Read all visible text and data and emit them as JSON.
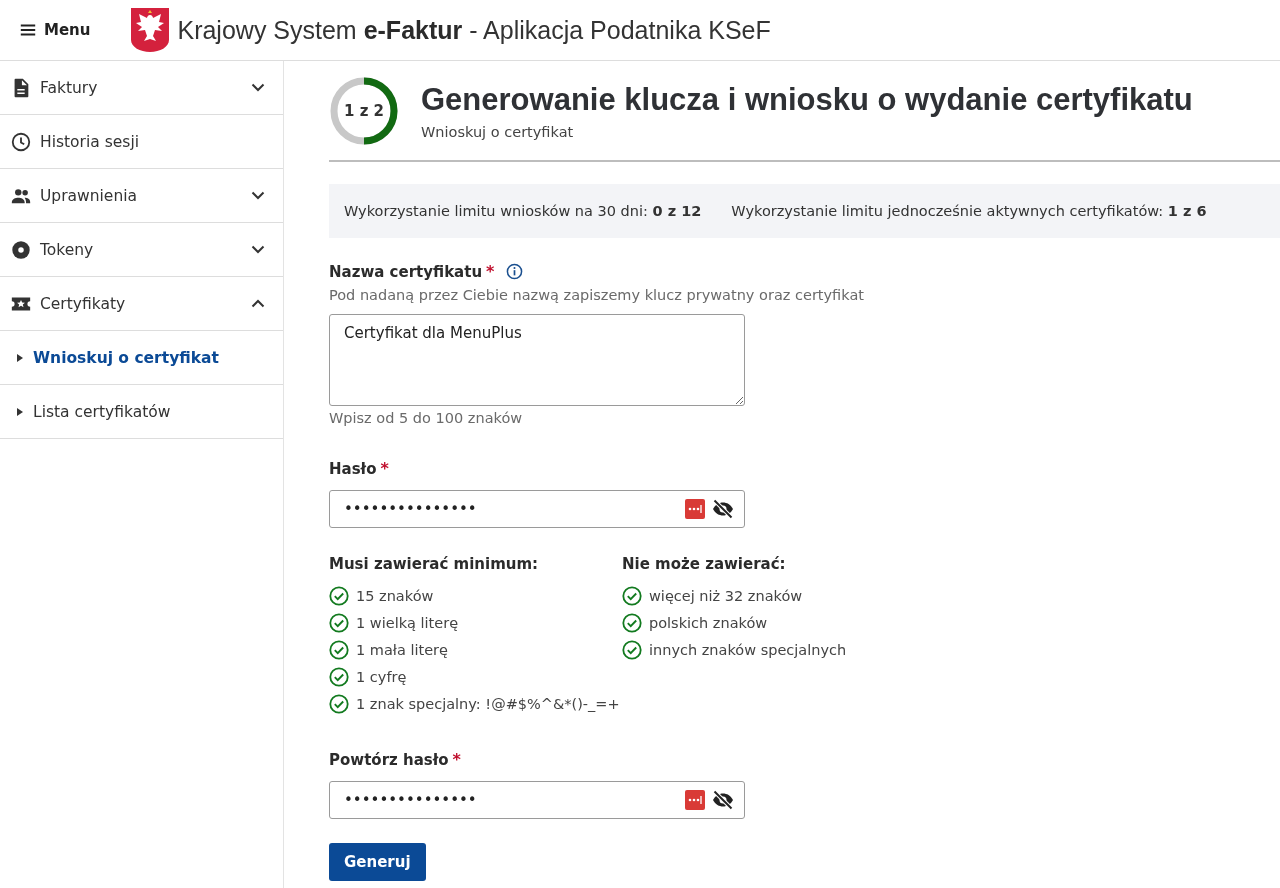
{
  "header": {
    "menu_label": "Menu",
    "title_prefix": "Krajowy System ",
    "title_brand": "e-Faktur",
    "title_suffix": " - Aplikacja Podatnika KSeF"
  },
  "sidebar": {
    "items": [
      {
        "label": "Faktury",
        "kind": "document",
        "expanded": false
      },
      {
        "label": "Historia sesji",
        "kind": "clock"
      },
      {
        "label": "Uprawnienia",
        "kind": "people",
        "expanded": false
      },
      {
        "label": "Tokeny",
        "kind": "token",
        "expanded": false
      },
      {
        "label": "Certyfikaty",
        "kind": "ticket",
        "expanded": true,
        "children": [
          {
            "label": "Wnioskuj o certyfikat",
            "selected": true
          },
          {
            "label": "Lista certyfikatów",
            "selected": false
          }
        ]
      }
    ]
  },
  "page": {
    "step": {
      "label": "1 z 2",
      "level": 0.5
    },
    "title": "Generowanie klucza i wniosku o wydanie certyfikatu",
    "subtitle": "Wnioskuj o certyfikat",
    "limits": [
      "Wykorzystanie limitu wniosków na 30 dni: **0 z 12**",
      "Wykorzystanie limitu jednocześnie aktywnych certyfikatów: **1 z 6**"
    ]
  },
  "form": {
    "name_field": {
      "label": "Nazwa certyfikatu",
      "required_mark": "*",
      "hint": "Pod nadaną przez Ciebie nazwą zapiszemy klucz prywatny oraz certyfikat",
      "value": "Certyfikat dla MenuPlus",
      "help": "Wpisz od 5 do 100 znaków"
    },
    "password": {
      "label": "Hasło",
      "required_mark": "*",
      "value": "•••••••••••••••"
    },
    "rule_groups": [
      {
        "title": "Musi zawierać minimum:",
        "rules": [
          {
            "text": "15 znaków",
            "met": true
          },
          {
            "text": "1 wielką literę",
            "met": true
          },
          {
            "text": "1 mała literę",
            "met": true
          },
          {
            "text": "1 cyfrę",
            "met": true
          },
          {
            "text": "1 znak specjalny: !@#$%^&*()-_=+",
            "met": true
          }
        ]
      },
      {
        "title": "Nie może zawierać:",
        "rules": [
          {
            "text": "więcej niż 32 znaków",
            "met": true
          },
          {
            "text": "polskich znaków",
            "met": true
          },
          {
            "text": "innych znaków specjalnych",
            "met": true
          }
        ]
      }
    ],
    "repeat_password": {
      "label": "Powtórz hasło",
      "required_mark": "*",
      "value": "•••••••••••••••"
    },
    "submit": "Generuj"
  }
}
